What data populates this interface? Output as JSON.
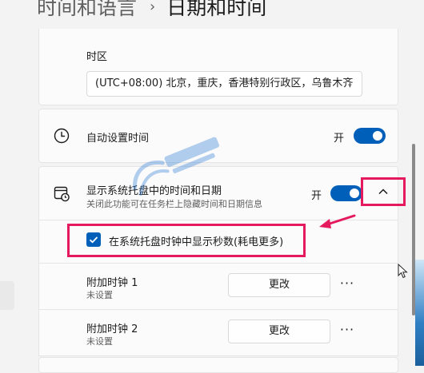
{
  "breadcrumb": {
    "parent": "时间和语言",
    "separator": "›",
    "current": "日期和时间"
  },
  "timezone": {
    "label": "时区",
    "value": "(UTC+08:00) 北京，重庆，香港特别行政区，乌鲁木齐"
  },
  "auto_time": {
    "title": "自动设置时间",
    "state": "开",
    "on": true
  },
  "tray": {
    "title": "显示系统托盘中的时间和日期",
    "desc": "关闭此功能可在任务栏上隐藏时间和日期信息",
    "state": "开",
    "on": true,
    "expanded": true
  },
  "seconds_option": {
    "label": "在系统托盘时钟中显示秒数(耗电更多)",
    "checked": true
  },
  "clocks": [
    {
      "title": "附加时钟 1",
      "status": "未设置",
      "button": "更改",
      "more": "···"
    },
    {
      "title": "附加时钟 2",
      "status": "未设置",
      "button": "更改",
      "more": "···"
    }
  ],
  "colors": {
    "accent": "#005fb8",
    "annotation": "#e5195e",
    "card_bg": "#fbfbfb",
    "page_bg": "#f3f3f3"
  },
  "icons": [
    "clock-icon",
    "calendar-clock-icon",
    "chevron-up-icon",
    "chevron-down-icon",
    "checkmark-icon",
    "more-icon",
    "cursor-icon",
    "annotation-arrow"
  ]
}
